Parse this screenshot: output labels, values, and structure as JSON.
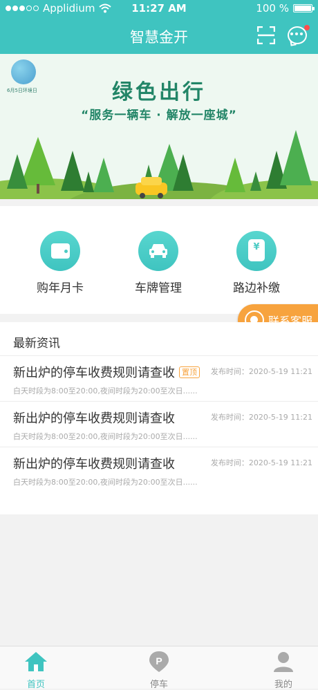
{
  "status_bar": {
    "carrier": "Applidium",
    "time": "11:27 AM",
    "battery": "100 %"
  },
  "header": {
    "title": "智慧金开"
  },
  "banner": {
    "title": "绿色出行",
    "subtitle": "“服务一辆车 · 解放一座城”",
    "logo_text": "6月5日环境日"
  },
  "menu": {
    "items": [
      {
        "label": "购年月卡",
        "icon": "wallet-icon"
      },
      {
        "label": "车牌管理",
        "icon": "car-icon"
      },
      {
        "label": "路边补缴",
        "icon": "money-jar-icon",
        "symbol": "¥"
      }
    ]
  },
  "customer_service": {
    "label": "联系客服"
  },
  "news": {
    "title": "最新资讯",
    "items": [
      {
        "headline": "新出炉的停车收费规则请查收",
        "tag": "置顶",
        "desc": "白天时段为8:00至20:00,夜间时段为20:00至次日......",
        "time": "发布时间：2020-5-19  11:21"
      },
      {
        "headline": "新出炉的停车收费规则请查收",
        "tag": "",
        "desc": "白天时段为8:00至20:00,夜间时段为20:00至次日......",
        "time": "发布时间：2020-5-19  11:21"
      },
      {
        "headline": "新出炉的停车收费规则请查收",
        "tag": "",
        "desc": "白天时段为8:00至20:00,夜间时段为20:00至次日......",
        "time": "发布时间：2020-5-19  11:21"
      }
    ]
  },
  "tabbar": {
    "items": [
      {
        "label": "首页",
        "icon": "home-icon",
        "active": true
      },
      {
        "label": "停车",
        "icon": "parking-pin-icon",
        "active": false
      },
      {
        "label": "我的",
        "icon": "user-icon",
        "active": false
      }
    ]
  },
  "colors": {
    "primary": "#3fc4c0",
    "accent": "#f7a33e",
    "banner_text": "#228567"
  }
}
